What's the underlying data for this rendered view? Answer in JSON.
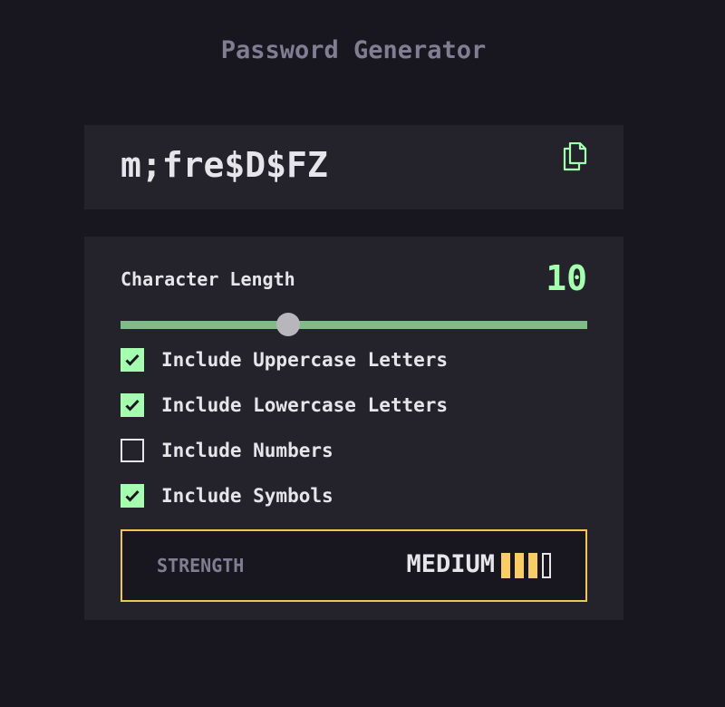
{
  "app": {
    "title": "Password Generator"
  },
  "output": {
    "password": "m;fre$D$FZ",
    "copy_icon": "copy-icon"
  },
  "length": {
    "label": "Character Length",
    "value": "10",
    "slider_fraction": 0.36
  },
  "options": [
    {
      "label": "Include Uppercase Letters",
      "checked": true
    },
    {
      "label": "Include Lowercase Letters",
      "checked": true
    },
    {
      "label": "Include Numbers",
      "checked": false
    },
    {
      "label": "Include Symbols",
      "checked": true
    }
  ],
  "strength": {
    "label": "STRENGTH",
    "level": "MEDIUM",
    "bars_filled": 3,
    "bars_total": 4
  },
  "colors": {
    "accent": "#a4ffaf",
    "strength_border": "#f2c654",
    "strength_bar": "#f8cd65",
    "background": "#18171f",
    "panel": "#24232c"
  }
}
